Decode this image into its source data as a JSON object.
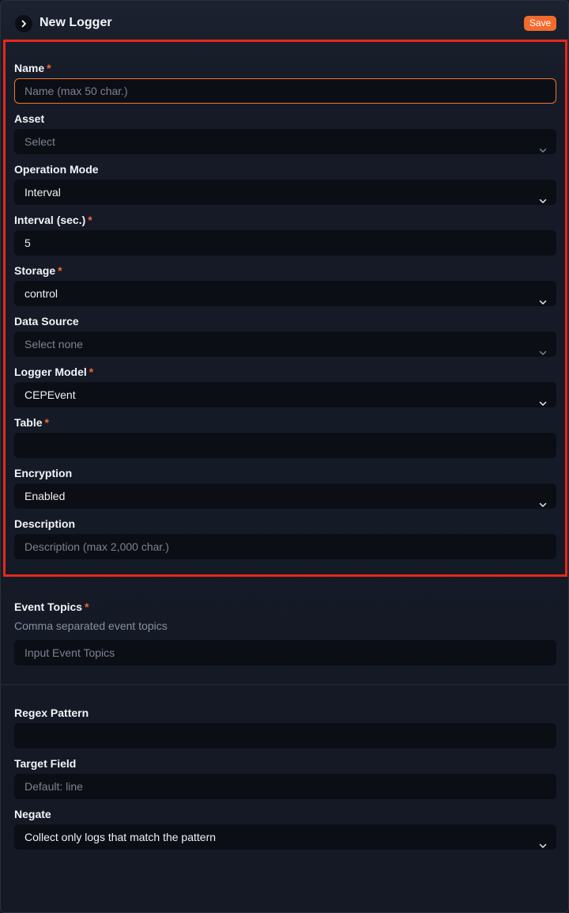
{
  "header": {
    "title": "New Logger",
    "save_label": "Save"
  },
  "form": {
    "name": {
      "label": "Name",
      "required": "*",
      "placeholder": "Name (max 50 char.)"
    },
    "asset": {
      "label": "Asset",
      "placeholder": "Select"
    },
    "operation_mode": {
      "label": "Operation Mode",
      "value": "Interval"
    },
    "interval": {
      "label": "Interval (sec.)",
      "required": "*",
      "value": "5"
    },
    "storage": {
      "label": "Storage",
      "required": "*",
      "value": "control"
    },
    "data_source": {
      "label": "Data Source",
      "placeholder": "Select none"
    },
    "logger_model": {
      "label": "Logger Model",
      "required": "*",
      "value": "CEPEvent"
    },
    "table": {
      "label": "Table",
      "required": "*",
      "value": ""
    },
    "encryption": {
      "label": "Encryption",
      "value": "Enabled"
    },
    "description": {
      "label": "Description",
      "placeholder": "Description (max 2,000 char.)"
    }
  },
  "event_topics": {
    "label": "Event Topics",
    "required": "*",
    "helper": "Comma separated event topics",
    "placeholder": "Input Event Topics"
  },
  "regex": {
    "pattern": {
      "label": "Regex Pattern",
      "value": ""
    },
    "target_field": {
      "label": "Target Field",
      "placeholder": "Default: line"
    },
    "negate": {
      "label": "Negate",
      "value": "Collect only logs that match the pattern"
    }
  },
  "colors": {
    "accent": "#f26b2c",
    "highlight": "#e8281a",
    "background": "#131722",
    "input_bg": "#0b0e15"
  },
  "icons": {
    "toggle": "chevron-right-icon",
    "dropdown": "chevron-down-icon"
  }
}
